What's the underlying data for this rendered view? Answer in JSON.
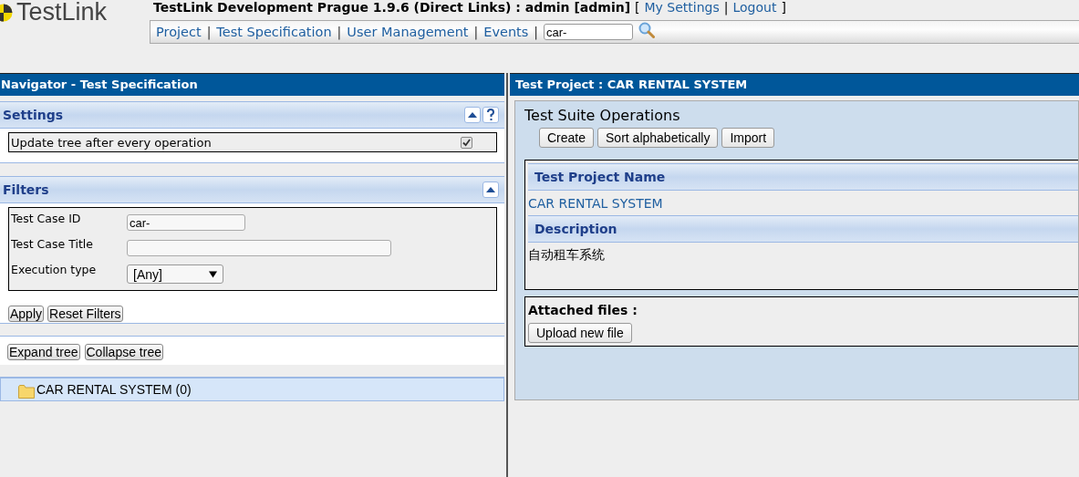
{
  "header": {
    "logo": "TestLink",
    "title": "TestLink Development Prague 1.9.6 (Direct Links) : admin [admin]",
    "bracket_open": "[",
    "bracket_close": "]",
    "link_separator": "|",
    "user_links": [
      "My Settings",
      "Logout"
    ]
  },
  "menu": {
    "items": [
      "Project",
      "Test Specification",
      "User Management",
      "Events"
    ],
    "separator": "|",
    "search": {
      "value": "car-"
    }
  },
  "navigator": {
    "title": "Navigator - Test Specification",
    "settings": {
      "title": "Settings",
      "option": {
        "label": "Update tree after every operation",
        "checked": true
      }
    },
    "filters": {
      "title": "Filters",
      "fields": [
        {
          "kind": "text",
          "label": "Test Case ID",
          "value": "car-"
        },
        {
          "kind": "text",
          "label": "Test Case Title"
        },
        {
          "kind": "select",
          "label": "Execution type",
          "value": "[Any]"
        }
      ],
      "buttons": [
        "Apply",
        "Reset Filters"
      ]
    },
    "tree_buttons": [
      "Expand tree",
      "Collapse tree"
    ],
    "tree": [
      {
        "label": "CAR RENTAL SYSTEM (0)",
        "selected": true
      }
    ]
  },
  "main": {
    "title": "Test Project : CAR RENTAL SYSTEM",
    "operations_title": "Test Suite Operations",
    "buttons": [
      "Create",
      "Sort alphabetically",
      "Import"
    ],
    "sections": [
      {
        "heading": "Test Project Name",
        "value": "CAR RENTAL SYSTEM",
        "kind": "link"
      },
      {
        "heading": "Description",
        "value": "自动租车系统",
        "kind": "text"
      }
    ],
    "attachments": {
      "title": "Attached files :",
      "button": "Upload new file"
    }
  }
}
